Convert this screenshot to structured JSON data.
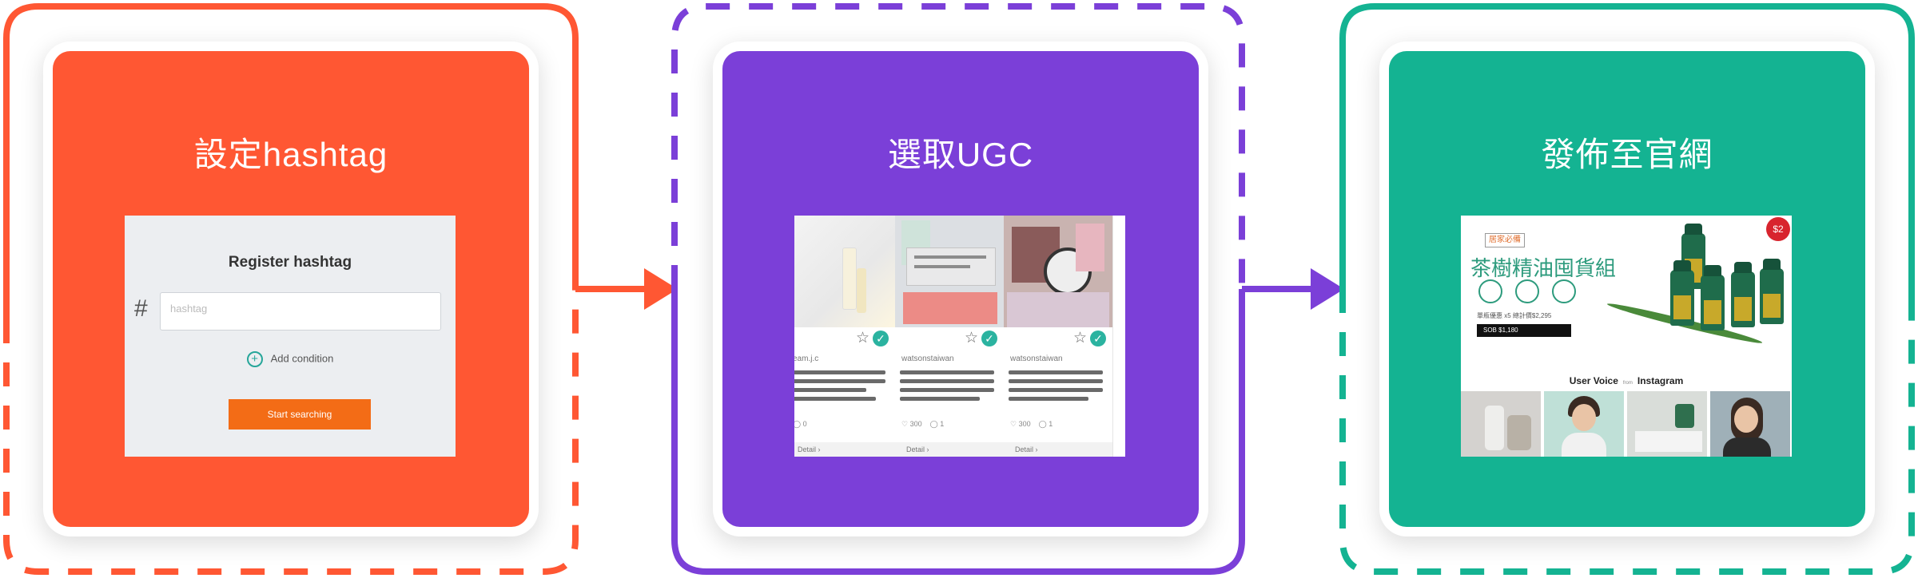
{
  "steps": [
    {
      "title": "設定hashtag",
      "color": "#ff5733",
      "border_color": "#ff5733"
    },
    {
      "title": "選取UGC",
      "color": "#7b3fd8",
      "border_color": "#7b3fd8"
    },
    {
      "title": "發佈至官網",
      "color": "#14b392",
      "border_color": "#14b392"
    }
  ],
  "register": {
    "title": "Register hashtag",
    "hash_symbol": "#",
    "input_placeholder": "hashtag",
    "add_condition_label": "Add condition",
    "start_button_label": "Start searching"
  },
  "ugc": {
    "posts": [
      {
        "username": "eam.j.c",
        "likes": "",
        "comments": "0",
        "detail_label": "Detail"
      },
      {
        "username": "watsonstaiwan",
        "likes": "300",
        "comments": "1",
        "detail_label": "Detail"
      },
      {
        "username": "watsonstaiwan",
        "likes": "300",
        "comments": "1",
        "detail_label": "Detail"
      }
    ]
  },
  "website": {
    "badge": "居家必備",
    "product_title": "茶樹精油囤貨組",
    "fine_print": "單瓶優惠 x5 總計價$2,295",
    "price_bar": "SOB $1,180",
    "sale_badge": "$2",
    "user_voice_label": "User Voice",
    "from_label": "from",
    "instagram_label": "Instagram"
  },
  "icons": [
    "plus-circle-icon",
    "star-icon",
    "check-icon",
    "heart-icon",
    "comment-icon",
    "chevron-right-icon",
    "instagram-icon"
  ]
}
